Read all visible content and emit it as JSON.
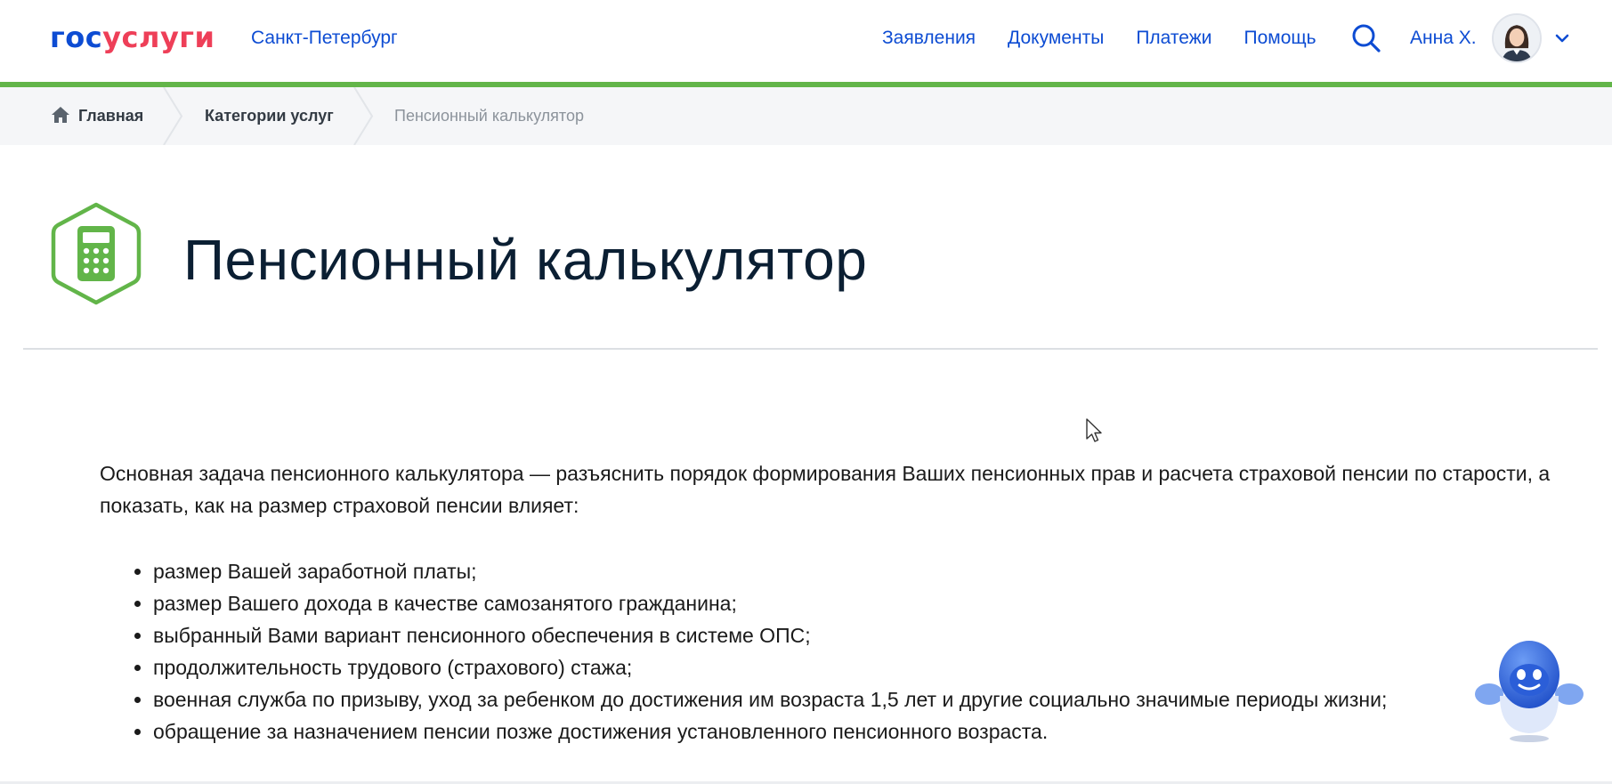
{
  "header": {
    "logo_part1": "гос",
    "logo_part2": "услуги",
    "region": "Санкт-Петербург",
    "nav": [
      "Заявления",
      "Документы",
      "Платежи",
      "Помощь"
    ],
    "user_name": "Анна Х.",
    "icons": {
      "search": "search-icon",
      "avatar": "avatar-icon",
      "dropdown": "chevron-down-icon"
    }
  },
  "breadcrumb": {
    "home": "Главная",
    "categories": "Категории услуг",
    "current": "Пенсионный калькулятор"
  },
  "page": {
    "title": "Пенсионный калькулятор",
    "icon": "calculator-icon",
    "intro_line1": "Основная задача пенсионного калькулятора — разъяснить порядок формирования Ваших пенсионных прав и расчета страховой пенсии по старости, а",
    "intro_line2": "показать, как на размер страховой пенсии влияет:",
    "factors": [
      "размер Вашей заработной платы;",
      "размер Вашего дохода в качестве самозанятого гражданина;",
      "выбранный Вами вариант пенсионного обеспечения в системе ОПС;",
      "продолжительность трудового (страхового) стажа;",
      "военная служба по призыву, уход за ребенком до достижения им возраста 1,5 лет и другие социально значимые периоды жизни;",
      "обращение за назначением пенсии позже достижения установленного пенсионного возраста."
    ]
  },
  "assistant": {
    "icon": "robot-assistant-icon"
  },
  "colors": {
    "brand_blue": "#0d4cd3",
    "brand_red": "#ee3f58",
    "accent_green": "#62b549",
    "breadcrumb_bg": "#f5f6f8"
  }
}
